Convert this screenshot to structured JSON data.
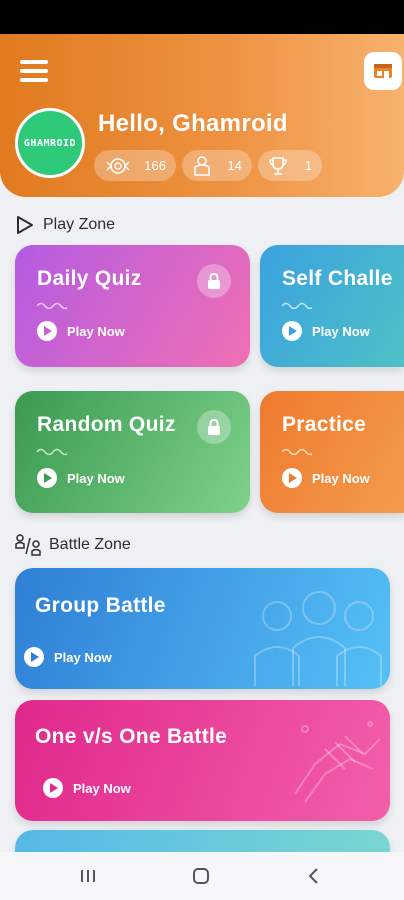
{
  "header": {
    "greeting": "Hello, Ghamroid",
    "avatar_text": "GHAMROID",
    "stats": [
      {
        "icon": "coins-icon",
        "value": "166"
      },
      {
        "icon": "hand-coin-icon",
        "value": "14"
      },
      {
        "icon": "trophy-icon",
        "value": "1"
      }
    ]
  },
  "play_zone": {
    "title": "Play Zone",
    "cards": [
      {
        "title": "Daily Quiz",
        "action": "Play Now",
        "locked": true,
        "colors": [
          "#b45be2",
          "#f06fb3"
        ]
      },
      {
        "title": "Self Challe",
        "action": "Play Now",
        "locked": false,
        "colors": [
          "#3aa2e0",
          "#4ec0c5"
        ]
      },
      {
        "title": "Random Quiz",
        "action": "Play Now",
        "locked": true,
        "colors": [
          "#3a9a50",
          "#7ed18b"
        ]
      },
      {
        "title": "Practice",
        "action": "Play Now",
        "locked": false,
        "colors": [
          "#ee7a2e",
          "#f49b4c"
        ]
      }
    ]
  },
  "battle_zone": {
    "title": "Battle Zone",
    "cards": [
      {
        "title": "Group Battle",
        "action": "Play Now",
        "colors": [
          "#2f7fd6",
          "#55c0f6"
        ]
      },
      {
        "title": "One v/s One Battle",
        "action": "Play Now",
        "colors": [
          "#e0288c",
          "#f35fa9"
        ]
      }
    ],
    "peek_colors": [
      "#55b8e8",
      "#7ad7d0"
    ]
  },
  "nav": {
    "items": [
      "recents-icon",
      "home-icon",
      "back-icon"
    ]
  }
}
